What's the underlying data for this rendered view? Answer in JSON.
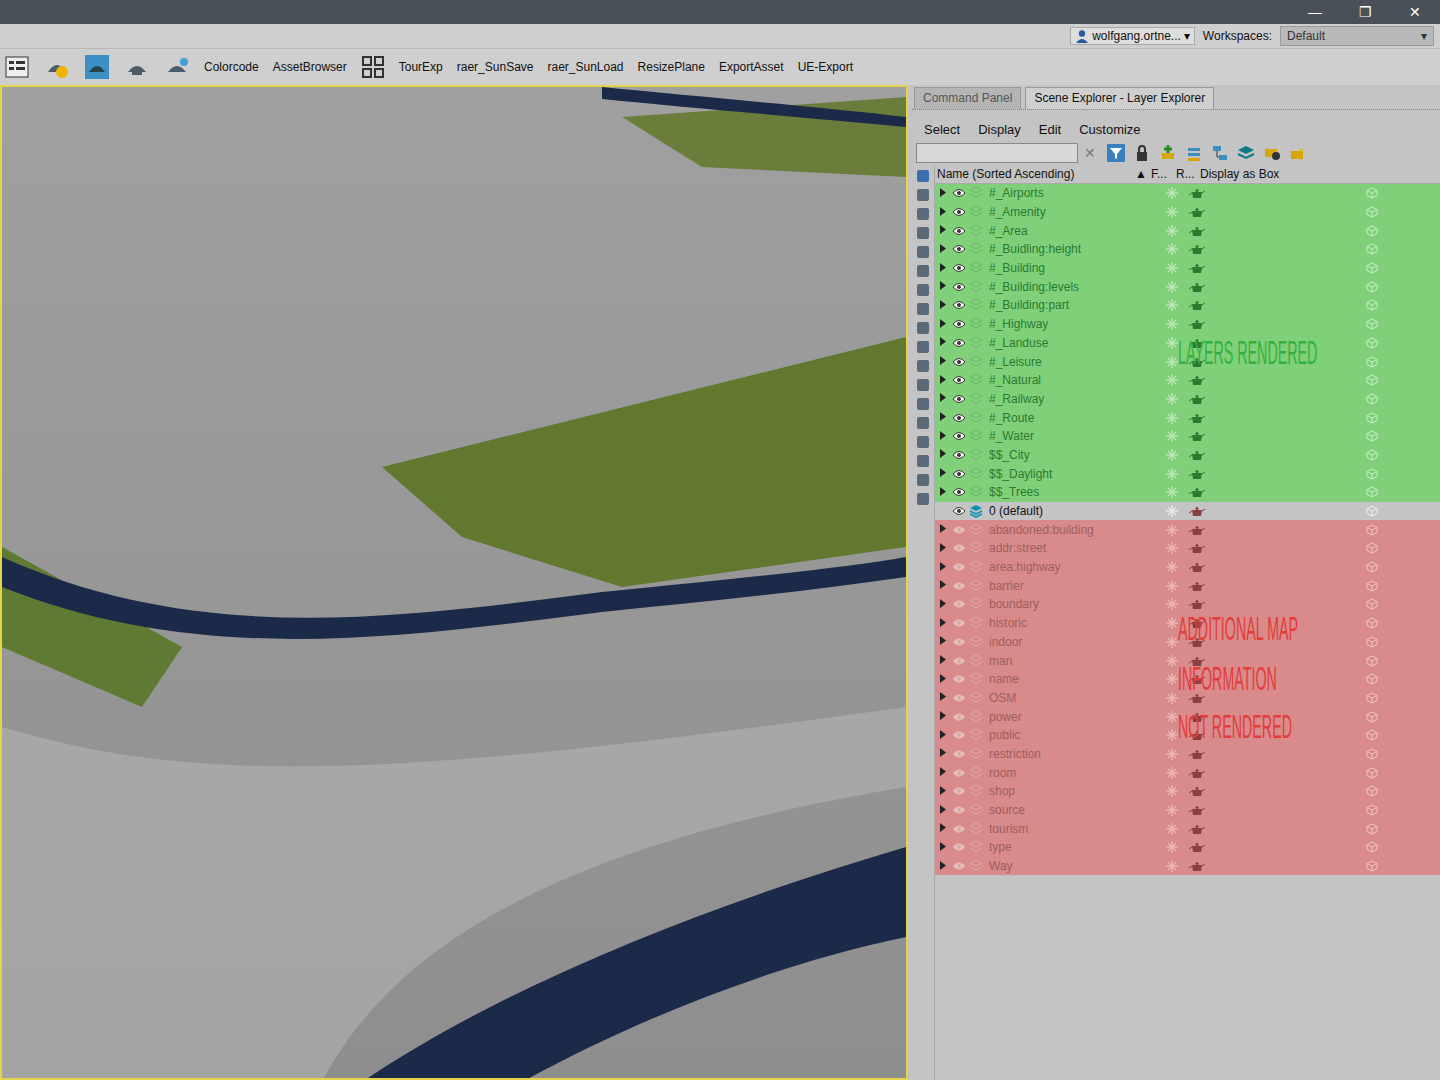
{
  "window": {
    "controls": [
      "—",
      "❐",
      "✕"
    ]
  },
  "user": {
    "name": "wolfgang.ortne...",
    "caret": "▾"
  },
  "workspaces": {
    "label": "Workspaces:",
    "value": "Default",
    "caret": "▾"
  },
  "toolbar": [
    "Colorcode",
    "AssetBrowser",
    "TourExp",
    "raer_SunSave",
    "raer_SunLoad",
    "ResizePlane",
    "ExportAsset",
    "UE-Export"
  ],
  "tabs": [
    {
      "label": "Command Panel",
      "selected": false
    },
    {
      "label": "Scene Explorer - Layer Explorer",
      "selected": true
    }
  ],
  "menu": [
    "Select",
    "Display",
    "Edit",
    "Customize"
  ],
  "search": {
    "clear": "✕"
  },
  "columns": {
    "name": "Name (Sorted Ascending)",
    "sort": "▲",
    "freeze": "F...",
    "render": "R...",
    "box": "Display as Box"
  },
  "layers": [
    {
      "name": "#_Airports",
      "kind": "rendered",
      "visible": true
    },
    {
      "name": "#_Amenity",
      "kind": "rendered",
      "visible": true
    },
    {
      "name": "#_Area",
      "kind": "rendered",
      "visible": true
    },
    {
      "name": "#_Buidling:height",
      "kind": "rendered",
      "visible": true
    },
    {
      "name": "#_Building",
      "kind": "rendered",
      "visible": true
    },
    {
      "name": "#_Building:levels",
      "kind": "rendered",
      "visible": true
    },
    {
      "name": "#_Building:part",
      "kind": "rendered",
      "visible": true
    },
    {
      "name": "#_Highway",
      "kind": "rendered",
      "visible": true
    },
    {
      "name": "#_Landuse",
      "kind": "rendered",
      "visible": true
    },
    {
      "name": "#_Leisure",
      "kind": "rendered",
      "visible": true
    },
    {
      "name": "#_Natural",
      "kind": "rendered",
      "visible": true
    },
    {
      "name": "#_Railway",
      "kind": "rendered",
      "visible": true
    },
    {
      "name": "#_Route",
      "kind": "rendered",
      "visible": true
    },
    {
      "name": "#_Water",
      "kind": "rendered",
      "visible": true
    },
    {
      "name": "$$_City",
      "kind": "rendered",
      "visible": true
    },
    {
      "name": "$$_Daylight",
      "kind": "rendered",
      "visible": true
    },
    {
      "name": "$$_Trees",
      "kind": "rendered",
      "visible": true
    },
    {
      "name": "0 (default)",
      "kind": "default",
      "visible": true
    },
    {
      "name": "abandoned:building",
      "kind": "hidden",
      "visible": false
    },
    {
      "name": "addr:street",
      "kind": "hidden",
      "visible": false
    },
    {
      "name": "area:highway",
      "kind": "hidden",
      "visible": false
    },
    {
      "name": "barrier",
      "kind": "hidden",
      "visible": false
    },
    {
      "name": "boundary",
      "kind": "hidden",
      "visible": false
    },
    {
      "name": "historic",
      "kind": "hidden",
      "visible": false
    },
    {
      "name": "indoor",
      "kind": "hidden",
      "visible": false
    },
    {
      "name": "man",
      "kind": "hidden",
      "visible": false
    },
    {
      "name": "name",
      "kind": "hidden",
      "visible": false
    },
    {
      "name": "OSM",
      "kind": "hidden",
      "visible": false
    },
    {
      "name": "power",
      "kind": "hidden",
      "visible": false
    },
    {
      "name": "public",
      "kind": "hidden",
      "visible": false
    },
    {
      "name": "restriction",
      "kind": "hidden",
      "visible": false
    },
    {
      "name": "room",
      "kind": "hidden",
      "visible": false
    },
    {
      "name": "shop",
      "kind": "hidden",
      "visible": false
    },
    {
      "name": "source",
      "kind": "hidden",
      "visible": false
    },
    {
      "name": "tourism",
      "kind": "hidden",
      "visible": false
    },
    {
      "name": "type",
      "kind": "hidden",
      "visible": false
    },
    {
      "name": "Way",
      "kind": "hidden",
      "visible": false
    }
  ],
  "annotations": [
    {
      "text": "LAYERS RENDERED",
      "color": "#35b040"
    },
    {
      "text": "ADDITIONAL MAP",
      "color": "#e23c3c"
    },
    {
      "text": "INFORMATION",
      "color": "#e23c3c"
    },
    {
      "text": "NOT RENDERED",
      "color": "#e23c3c"
    }
  ]
}
